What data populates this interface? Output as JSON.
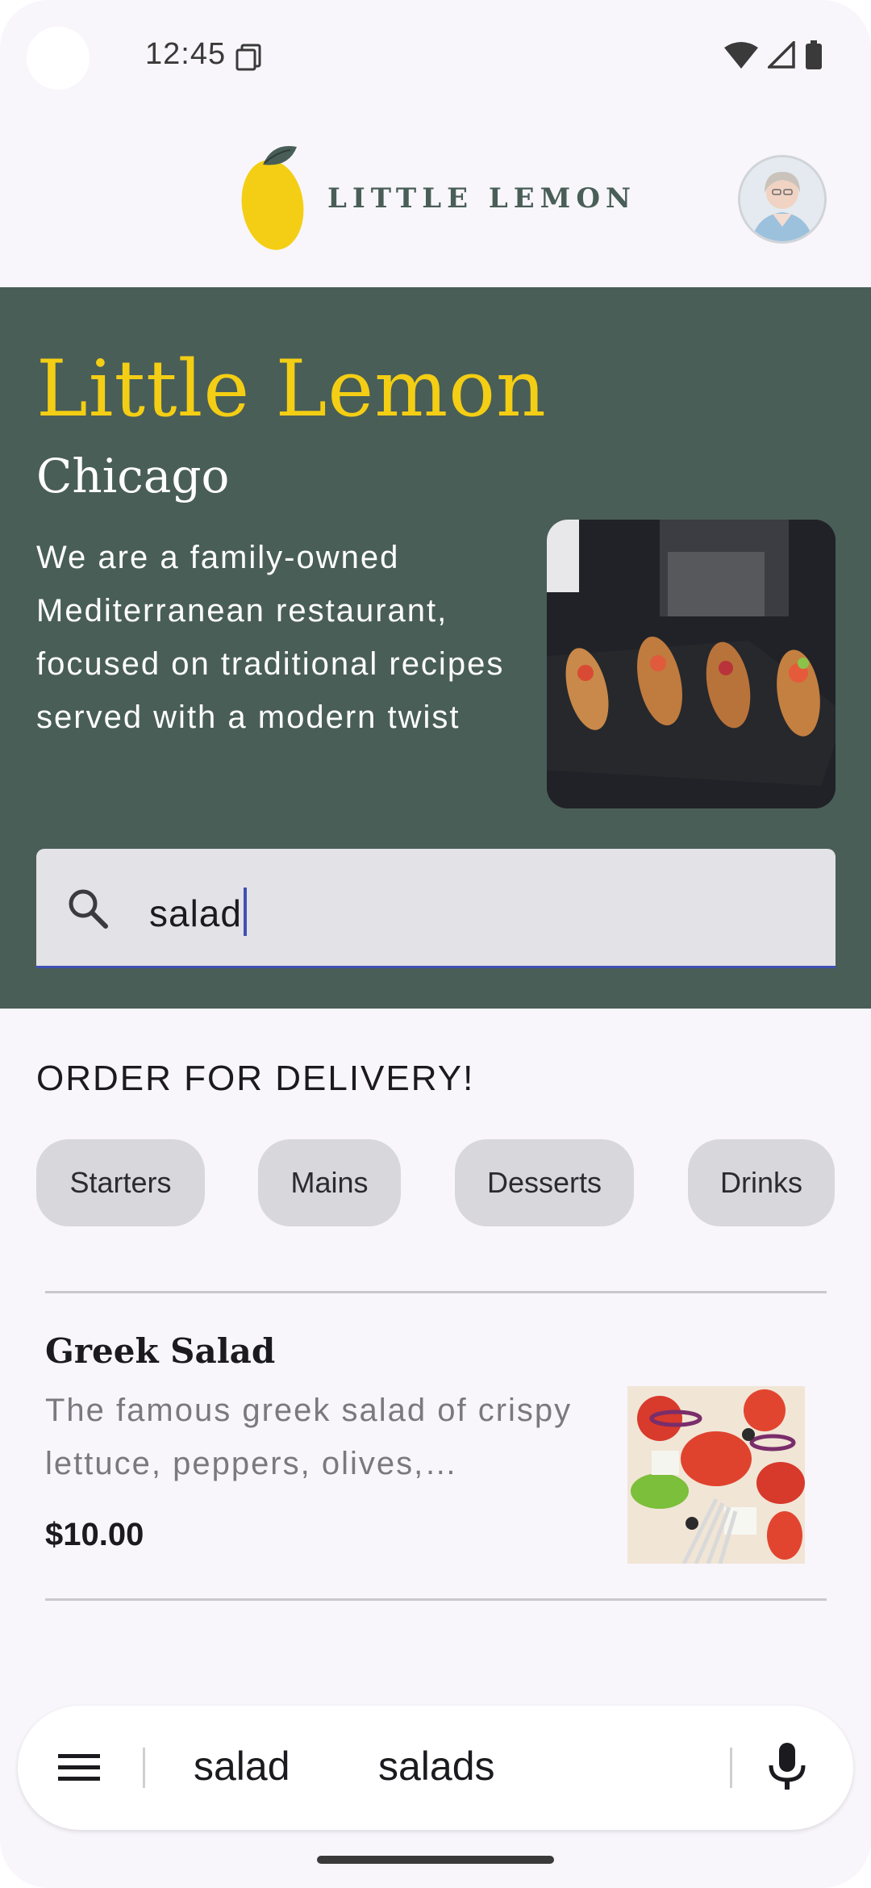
{
  "status_bar": {
    "time": "12:45"
  },
  "header": {
    "logo_text": "LITTLE LEMON"
  },
  "hero": {
    "title": "Little Lemon",
    "city": "Chicago",
    "description": "We are a family-owned Mediterranean restaurant, focused on traditional recipes served with a modern twist"
  },
  "search": {
    "value": "salad"
  },
  "order": {
    "title": "ORDER FOR DELIVERY!",
    "categories": [
      "Starters",
      "Mains",
      "Desserts",
      "Drinks"
    ]
  },
  "menu_items": [
    {
      "name": "Greek Salad",
      "description": "The famous greek salad of crispy lettuce, peppers, olives,…",
      "price": "$10.00"
    }
  ],
  "keyboard": {
    "suggestions": [
      "salad",
      "salads"
    ]
  },
  "colors": {
    "primary_green": "#495e57",
    "accent_yellow": "#f4ce14",
    "background": "#f8f6fb",
    "chip_bg": "#d8d7db",
    "search_bg": "#e3e2e6",
    "focus_indicator": "#3f51b5"
  },
  "icons": [
    "sim-icon",
    "wifi-icon",
    "signal-icon",
    "battery-icon",
    "lemon-logo-icon",
    "search-icon",
    "menu-icon",
    "mic-icon"
  ]
}
